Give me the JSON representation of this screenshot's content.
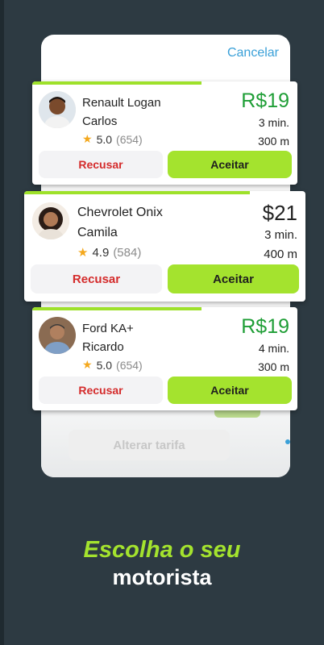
{
  "background_screen": {
    "cancel_label": "Cancelar",
    "change_fare_label": "Alterar tarifa"
  },
  "offers": [
    {
      "car": "Renault Logan",
      "driver": "Carlos",
      "rating": "5.0",
      "reviews": "(654)",
      "price": "R$19",
      "eta": "3 min.",
      "distance": "300 m",
      "decline_label": "Recusar",
      "accept_label": "Aceitar"
    },
    {
      "car": "Chevrolet Onix",
      "driver": "Camila",
      "rating": "4.9",
      "reviews": "(584)",
      "price": "$21",
      "eta": "3 min.",
      "distance": "400 m",
      "decline_label": "Recusar",
      "accept_label": "Aceitar"
    },
    {
      "car": "Ford KA+",
      "driver": "Ricardo",
      "rating": "5.0",
      "reviews": "(654)",
      "price": "R$19",
      "eta": "4 min.",
      "distance": "300 m",
      "decline_label": "Recusar",
      "accept_label": "Aceitar"
    }
  ],
  "tagline": {
    "line1": "Escolha o seu",
    "line2": "motorista"
  },
  "icons": {
    "rating": "star-icon"
  },
  "colors": {
    "background": "#2d3a42",
    "accent_green": "#a4e32e",
    "price_green": "#1f9e36",
    "decline_red": "#d42b2b",
    "link_blue": "#3aa0d8",
    "star": "#f4a81d"
  }
}
